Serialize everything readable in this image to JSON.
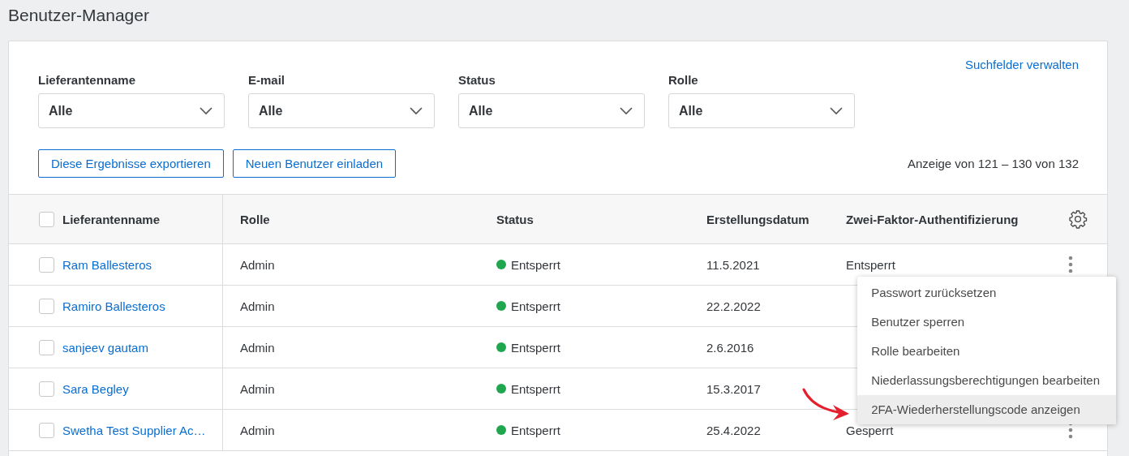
{
  "page_title": "Benutzer-Manager",
  "manage_link": "Suchfelder verwalten",
  "filters": [
    {
      "label": "Lieferantenname",
      "value": "Alle"
    },
    {
      "label": "E-mail",
      "value": "Alle"
    },
    {
      "label": "Status",
      "value": "Alle"
    },
    {
      "label": "Rolle",
      "value": "Alle"
    }
  ],
  "buttons": [
    "Diese Ergebnisse exportieren",
    "Neuen Benutzer einladen"
  ],
  "result_count": "Anzeige von 121 – 130 von 132",
  "table": {
    "select_all_checked": false,
    "columns": [
      "Lieferantenname",
      "Rolle",
      "Status",
      "Erstellungsdatum",
      "Zwei-Faktor-Authentifizierung"
    ],
    "rows": [
      {
        "name": "Ram Ballesteros",
        "checked": false,
        "role": "Admin",
        "status": "Entsperrt",
        "color": "#1fa64f",
        "created": "11.5.2021",
        "two_factor": "Entsperrt"
      },
      {
        "name": "Ramiro Ballesteros",
        "checked": false,
        "role": "Admin",
        "status": "Entsperrt",
        "color": "#1fa64f",
        "created": "22.2.2022"
      },
      {
        "name": "sanjeev gautam",
        "checked": false,
        "role": "Admin",
        "status": "Entsperrt",
        "color": "#1fa64f",
        "created": "2.6.2016"
      },
      {
        "name": "Sara Begley",
        "checked": false,
        "role": "Admin",
        "status": "Entsperrt",
        "color": "#1fa64f",
        "created": "15.3.2017"
      },
      {
        "name": "Swetha Test Supplier Ac…",
        "checked": false,
        "role": "Admin",
        "status": "Entsperrt",
        "color": "#1fa64f",
        "created": "25.4.2022",
        "two_factor": "Gesperrt"
      }
    ]
  },
  "row_menu": [
    {
      "label": "Passwort zurücksetzen",
      "selected": false
    },
    {
      "label": "Benutzer sperren",
      "selected": false
    },
    {
      "label": "Rolle bearbeiten",
      "selected": false
    },
    {
      "label": "Niederlassungsberechtigungen bearbeiten",
      "selected": false
    },
    {
      "label": "2FA-Wiederherstellungscode anzeigen",
      "selected": true
    }
  ]
}
